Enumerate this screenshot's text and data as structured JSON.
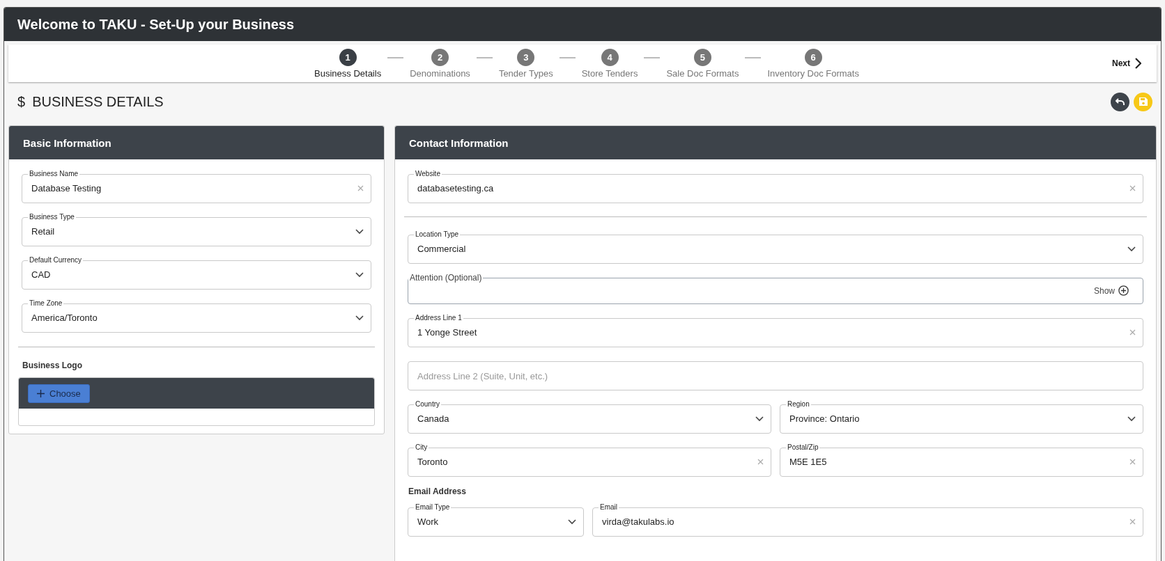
{
  "window": {
    "title": "Welcome to TAKU - Set-Up your Business"
  },
  "steps": [
    {
      "number": "1",
      "label": "Business Details",
      "selected": true
    },
    {
      "number": "2",
      "label": "Denominations",
      "selected": false
    },
    {
      "number": "3",
      "label": "Tender Types",
      "selected": false
    },
    {
      "number": "4",
      "label": "Store Tenders",
      "selected": false
    },
    {
      "number": "5",
      "label": "Sale Doc Formats",
      "selected": false
    },
    {
      "number": "6",
      "label": "Inventory Doc Formats",
      "selected": false
    }
  ],
  "next_button": "Next",
  "page": {
    "icon": "$",
    "title": "BUSINESS DETAILS"
  },
  "basic": {
    "title": "Basic Information",
    "fields": [
      {
        "kind": "text",
        "label": "Business Name",
        "value": "Database Testing"
      },
      {
        "kind": "select",
        "label": "Business Type",
        "value": "Retail"
      },
      {
        "kind": "select",
        "label": "Default Currency",
        "value": "CAD"
      },
      {
        "kind": "select",
        "label": "Time Zone",
        "value": "America/Toronto"
      }
    ],
    "logo_heading": "Business Logo",
    "choose_button": "Choose"
  },
  "contact": {
    "title": "Contact Information",
    "website": {
      "kind": "text",
      "label": "Website",
      "value": "databasetesting.ca"
    },
    "address_rows": [
      [
        {
          "kind": "select",
          "label": "Location Type",
          "value": "Commercial"
        }
      ],
      [
        {
          "kind": "toggle",
          "label": "Attention (Optional)",
          "action": "Show"
        }
      ],
      [
        {
          "kind": "text",
          "label": "Address Line 1",
          "value": "1 Yonge Street"
        }
      ],
      [
        {
          "kind": "text",
          "placeholder": "Address Line 2 (Suite, Unit, etc.)"
        }
      ],
      [
        {
          "kind": "select",
          "label": "Country",
          "value": "Canada"
        },
        {
          "kind": "select",
          "label": "Region",
          "value": "Province: Ontario"
        }
      ],
      [
        {
          "kind": "text",
          "label": "City",
          "value": "Toronto"
        },
        {
          "kind": "text",
          "label": "Postal/Zip",
          "value": "M5E 1E5"
        }
      ]
    ],
    "email_heading": "Email Address",
    "email_row": [
      {
        "kind": "select",
        "label": "Email Type",
        "value": "Work"
      },
      {
        "kind": "text",
        "label": "Email",
        "value": "virda@takulabs.io"
      }
    ]
  }
}
